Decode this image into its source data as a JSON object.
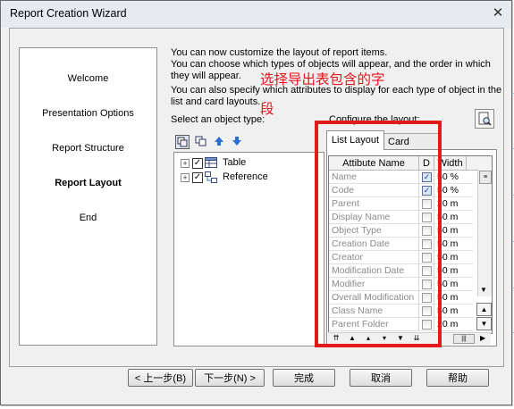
{
  "window": {
    "title": "Report Creation Wizard",
    "close_glyph": "✕"
  },
  "steps": [
    {
      "label": "Welcome",
      "current": false
    },
    {
      "label": "Presentation Options",
      "current": false
    },
    {
      "label": "Report Structure",
      "current": false
    },
    {
      "label": "Report Layout",
      "current": true
    },
    {
      "label": "End",
      "current": false
    }
  ],
  "instructions": {
    "line1": "You can now customize the layout of report items.",
    "line2": "You can choose which types of objects will appear, and the order in which",
    "line3": "they will appear.",
    "line4": "You can also specify which attributes to display for each type of object in the",
    "line5": "list and card layouts."
  },
  "object_type_label": "Select an object type:",
  "configure_label": "Configure the layout:",
  "toolbar_icons": [
    "properties-icon",
    "copy-icon",
    "move-up-icon",
    "move-down-icon"
  ],
  "tree": [
    {
      "label": "Table",
      "checked": true,
      "icon": "table-icon"
    },
    {
      "label": "Reference",
      "checked": true,
      "icon": "reference-icon"
    }
  ],
  "tabs": {
    "list": "List Layout",
    "card": "Card Layout"
  },
  "grid": {
    "headers": {
      "name": "Attibute Name",
      "display": "D",
      "width": "Width"
    },
    "rows": [
      {
        "name": "Name",
        "checked": true,
        "width": "50 %"
      },
      {
        "name": "Code",
        "checked": true,
        "width": "50 %"
      },
      {
        "name": "Parent",
        "checked": false,
        "width": "20 m"
      },
      {
        "name": "Display Name",
        "checked": false,
        "width": "50 m"
      },
      {
        "name": "Object Type",
        "checked": false,
        "width": "50 m"
      },
      {
        "name": "Creation Date",
        "checked": false,
        "width": "50 m"
      },
      {
        "name": "Creator",
        "checked": false,
        "width": "50 m"
      },
      {
        "name": "Modification Date",
        "checked": false,
        "width": "50 m"
      },
      {
        "name": "Modifier",
        "checked": false,
        "width": "50 m"
      },
      {
        "name": "Overall Modification",
        "checked": false,
        "width": "50 m"
      },
      {
        "name": "Class Name",
        "checked": false,
        "width": "50 m"
      },
      {
        "name": "Parent Folder",
        "checked": false,
        "width": "20 m"
      }
    ]
  },
  "annotation": {
    "line1": "选择导出表包含的字",
    "line2": "段",
    "color": "#e4161e"
  },
  "buttons": {
    "back": "< 上一步(B)",
    "next": "下一步(N) >",
    "finish": "完成",
    "cancel": "取消",
    "help": "帮助"
  },
  "check_glyph": "✓"
}
